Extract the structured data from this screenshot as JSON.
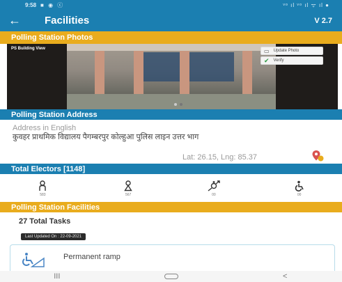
{
  "status_bar": {
    "time": "9:58",
    "status_icons": "■ ◉ ⓒ",
    "right_icons": "ᵛᵒ ıl ᵛᵒ ıl ᯤ ıl ●"
  },
  "app_bar": {
    "back_icon": "←",
    "title": "Facilities",
    "version": "V 2.7"
  },
  "photos_section": {
    "header": "Polling Station Photos",
    "photo_label": "PS Building View",
    "update_photo_label": "Update Photo",
    "verify_label": "Verify"
  },
  "address_section": {
    "header": "Polling Station Address",
    "address_label": "Address in English",
    "address_text": "कुवहर प्राथमिक विद्यालय पैगम्बरपुर कोल्हुआ पुलिस लाइन उत्तर भाग",
    "lat_lng": "Lat: 26.15, Lng: 85.37"
  },
  "electors_section": {
    "header": "Total Electors [1148]",
    "categories": [
      {
        "icon": "male-icon",
        "count": "583"
      },
      {
        "icon": "female-icon",
        "count": "567"
      },
      {
        "icon": "third-gender-icon",
        "count": "00"
      },
      {
        "icon": "disabled-icon",
        "count": "00"
      }
    ]
  },
  "facilities_section": {
    "header": "Polling Station Facilities",
    "total_tasks": "27 Total Tasks",
    "last_updated": "Last Updated On : 22-09-2021",
    "items": [
      {
        "name": "Permanent ramp",
        "icon": "wheelchair-ramp-icon"
      }
    ]
  },
  "nav_bar": {
    "recents": "III",
    "back": "<"
  },
  "colors": {
    "primary": "#1b7fb1",
    "accent": "#e9ac1d"
  }
}
